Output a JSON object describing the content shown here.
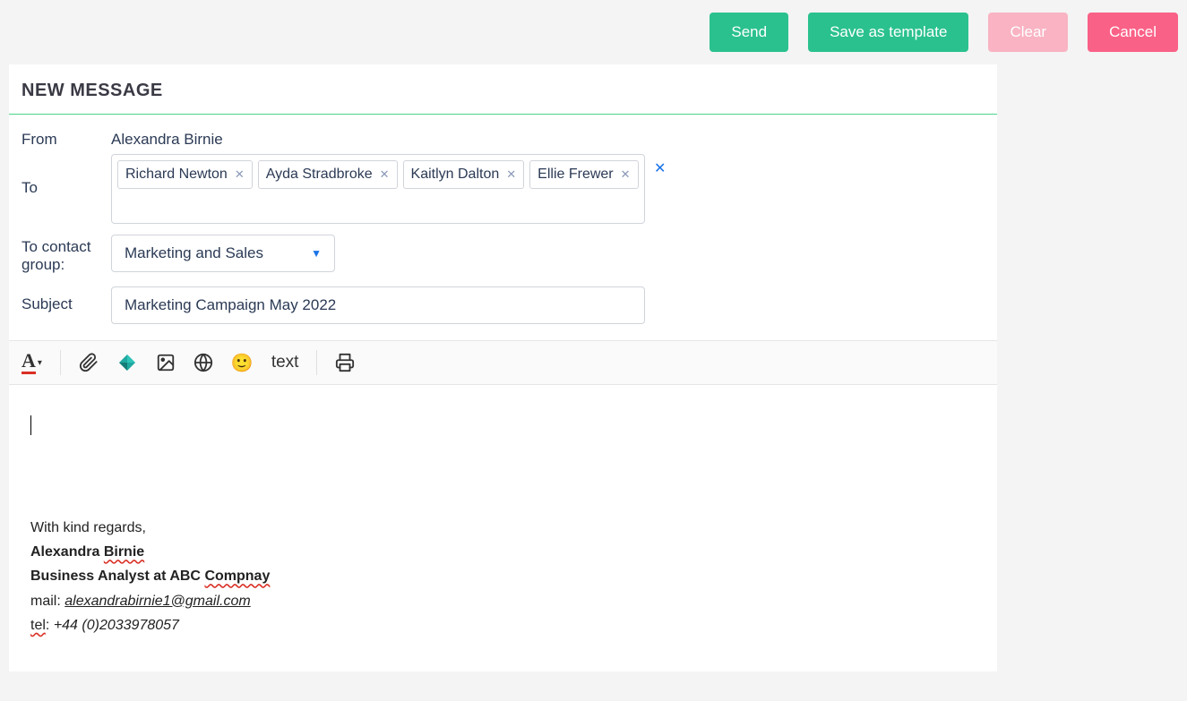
{
  "buttons": {
    "send": "Send",
    "save_template": "Save as template",
    "clear": "Clear",
    "cancel": "Cancel"
  },
  "panel": {
    "title": "NEW MESSAGE"
  },
  "form": {
    "from_label": "From",
    "from_value": "Alexandra Birnie",
    "to_label": "To",
    "to_recipients": [
      "Richard Newton",
      "Ayda Stradbroke",
      "Kaitlyn Dalton",
      "Ellie Frewer"
    ],
    "to_group_label": "To contact group:",
    "to_group_value": "Marketing and Sales",
    "subject_label": "Subject",
    "subject_value": "Marketing Campaign May 2022"
  },
  "toolbar": {
    "text_mode": "text"
  },
  "signature": {
    "regards": "With kind regards,",
    "name_first": "Alexandra",
    "name_last": "Birnie",
    "role_prefix": "Business Analyst at ABC",
    "company": "Compnay",
    "mail_label": "mail:",
    "mail_value": "alexandrabirnie1@gmail.com",
    "tel_label": "tel",
    "tel_sep": ":",
    "tel_value": "+44 (0)2033978057"
  }
}
